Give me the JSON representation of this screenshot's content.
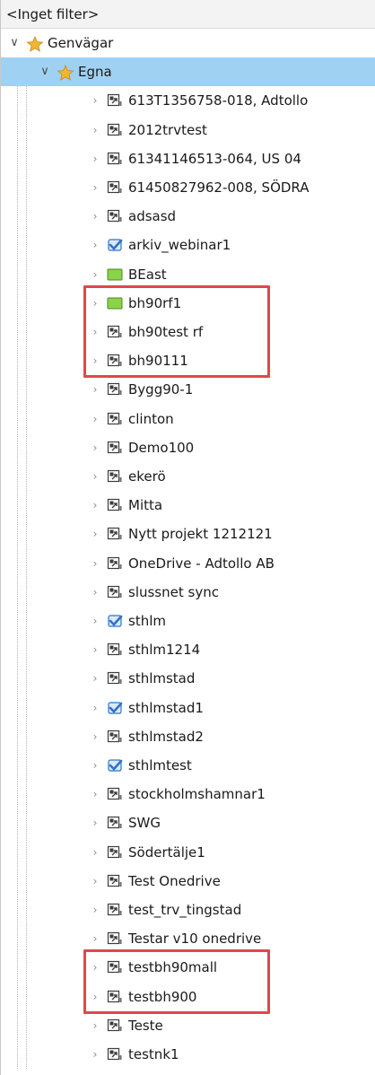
{
  "filter_label": "<Inget filter>",
  "root": {
    "label": "Genvägar",
    "icon": "star-icon",
    "expanded": true
  },
  "folder": {
    "label": "Egna",
    "icon": "star-icon",
    "expanded": true,
    "selected": true
  },
  "items": [
    {
      "label": "613T1356758-018, Adtollo",
      "icon": "shortcut-icon"
    },
    {
      "label": "2012trvtest",
      "icon": "shortcut-icon"
    },
    {
      "label": "61341146513-064, US 04",
      "icon": "shortcut-icon"
    },
    {
      "label": "61450827962-008, SÖDRA",
      "icon": "shortcut-icon"
    },
    {
      "label": "adsasd",
      "icon": "shortcut-icon"
    },
    {
      "label": "arkiv_webinar1",
      "icon": "checked-shortcut-icon"
    },
    {
      "label": "BEast",
      "icon": "green-box-icon"
    },
    {
      "label": "bh90rf1",
      "icon": "green-box-icon"
    },
    {
      "label": "bh90test rf",
      "icon": "shortcut-icon"
    },
    {
      "label": "bh90111",
      "icon": "shortcut-icon"
    },
    {
      "label": "Bygg90-1",
      "icon": "shortcut-icon"
    },
    {
      "label": "clinton",
      "icon": "shortcut-icon"
    },
    {
      "label": "Demo100",
      "icon": "shortcut-icon"
    },
    {
      "label": "ekerö",
      "icon": "shortcut-icon"
    },
    {
      "label": "Mitta",
      "icon": "shortcut-icon"
    },
    {
      "label": "Nytt projekt 1212121",
      "icon": "shortcut-icon"
    },
    {
      "label": "OneDrive - Adtollo AB",
      "icon": "shortcut-icon"
    },
    {
      "label": "slussnet sync",
      "icon": "shortcut-icon"
    },
    {
      "label": "sthlm",
      "icon": "checked-shortcut-icon"
    },
    {
      "label": "sthlm1214",
      "icon": "shortcut-icon"
    },
    {
      "label": "sthlmstad",
      "icon": "shortcut-icon"
    },
    {
      "label": "sthlmstad1",
      "icon": "checked-shortcut-icon"
    },
    {
      "label": "sthlmstad2",
      "icon": "shortcut-icon"
    },
    {
      "label": "sthlmtest",
      "icon": "checked-shortcut-icon"
    },
    {
      "label": "stockholmshamnar1",
      "icon": "shortcut-icon"
    },
    {
      "label": "SWG",
      "icon": "shortcut-icon"
    },
    {
      "label": "Södertälje1",
      "icon": "shortcut-icon"
    },
    {
      "label": "Test Onedrive",
      "icon": "shortcut-icon"
    },
    {
      "label": "test_trv_tingstad",
      "icon": "shortcut-icon"
    },
    {
      "label": "Testar v10 onedrive",
      "icon": "shortcut-icon"
    },
    {
      "label": "testbh90mall",
      "icon": "shortcut-icon"
    },
    {
      "label": "testbh900",
      "icon": "shortcut-icon"
    },
    {
      "label": "Teste",
      "icon": "shortcut-icon"
    },
    {
      "label": "testnk1",
      "icon": "shortcut-icon"
    }
  ],
  "highlight_groups": [
    {
      "name": "highlight-box-bh90",
      "items": [
        "bh90rf1",
        "bh90test rf",
        "bh90111"
      ]
    },
    {
      "name": "highlight-box-testbh",
      "items": [
        "testbh90mall",
        "testbh900"
      ]
    }
  ],
  "colors": {
    "selected_row": "#9fd1f2",
    "highlight_border": "#e0474c",
    "star": "#f2b632",
    "green_box": "#8ad34a",
    "check_blue": "#2e74c8"
  }
}
